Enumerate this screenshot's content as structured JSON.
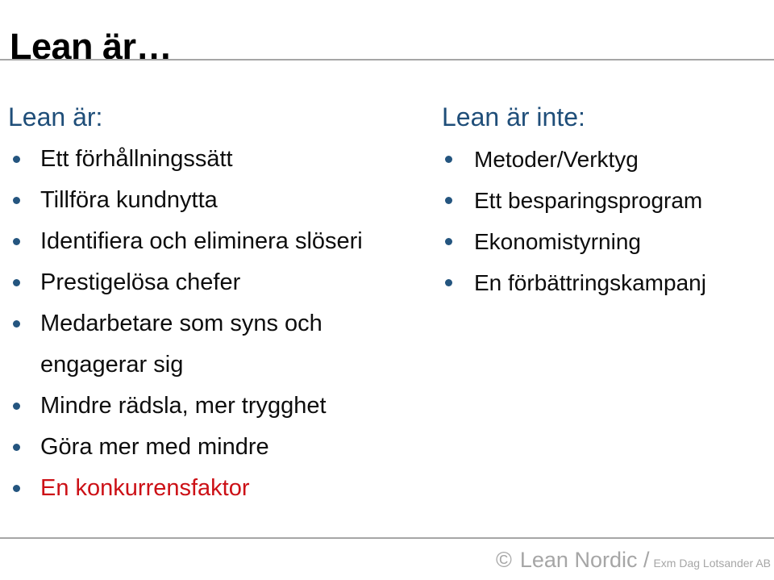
{
  "slide": {
    "title": "Lean är…",
    "colors": {
      "heading_blue": "#1F4E79",
      "bullet_blue": "#24557F",
      "accent_red": "#CC1016",
      "body_text": "#0D0D0D",
      "rule_gray": "#A6A6A6",
      "footer_gray": "#A6A6A6"
    }
  },
  "left_column": {
    "heading": "Lean är:",
    "bullets": [
      {
        "text": "Ett förhållningssätt",
        "style": "normal"
      },
      {
        "text": "Tillföra kundnytta",
        "style": "normal"
      },
      {
        "text": "Identifiera och eliminera slöseri",
        "style": "normal"
      },
      {
        "text": "Prestigelösa chefer",
        "style": "normal"
      },
      {
        "text": "Medarbetare som syns och engagerar sig",
        "style": "normal"
      },
      {
        "text": "Mindre rädsla, mer trygghet",
        "style": "normal"
      },
      {
        "text": "Göra mer med mindre",
        "style": "normal"
      },
      {
        "text": "En konkurrensfaktor",
        "style": "accent-red"
      }
    ]
  },
  "right_column": {
    "heading": "Lean är inte:",
    "bullets": [
      {
        "text": "Metoder/Verktyg",
        "style": "normal"
      },
      {
        "text": "Ett besparingsprogram",
        "style": "normal"
      },
      {
        "text": "Ekonomistyrning",
        "style": "normal"
      },
      {
        "text": "En förbättringskampanj",
        "style": "normal"
      }
    ]
  },
  "footer": {
    "copyright_symbol": "©",
    "brand": "Lean Nordic /",
    "legal": "Exm Dag Lotsander AB"
  }
}
